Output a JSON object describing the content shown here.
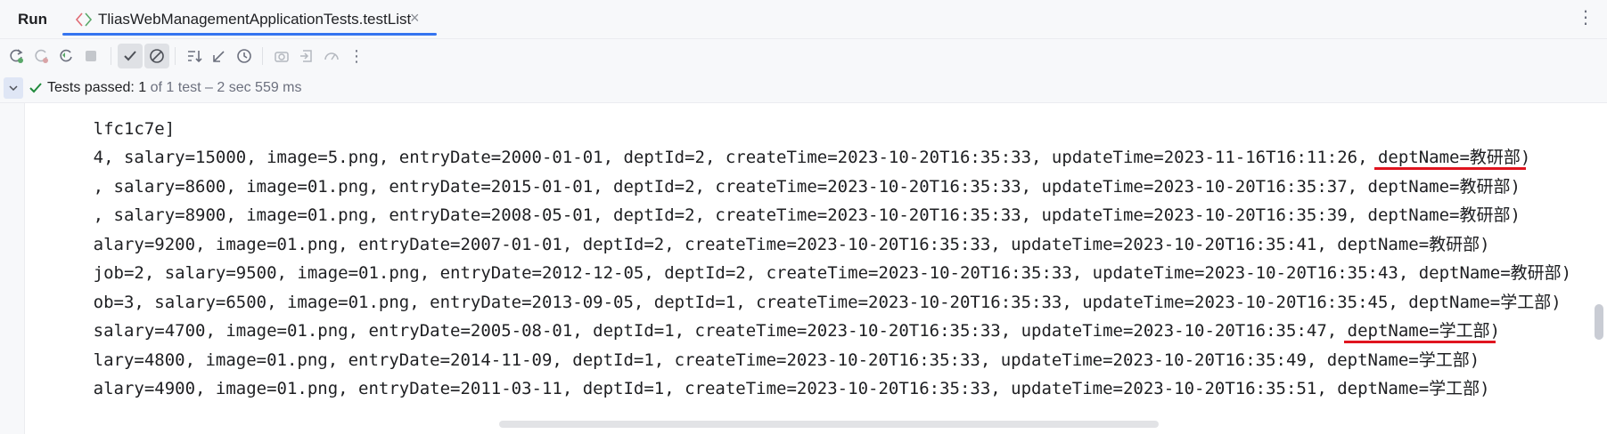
{
  "run_panel": {
    "title": "Run",
    "tab": {
      "label": "TliasWebManagementApplicationTests.testList",
      "close": "×"
    }
  },
  "toolbar": {
    "buttons": [
      "rerun-icon",
      "rerun-failed-icon",
      "rerun-auto-icon",
      "stop-icon",
      "show-passed-icon",
      "show-ignored-icon",
      "sort-icon",
      "collapse-all-icon",
      "history-icon",
      "screenshot-icon",
      "export-icon",
      "coverage-icon",
      "more-icon"
    ]
  },
  "status": {
    "label": "Tests passed:",
    "passed": "1",
    "detail": "of 1 test – 2 sec 559 ms"
  },
  "console": {
    "lines": [
      {
        "text": "lfc1c7e]",
        "hl": "",
        "tail": ""
      },
      {
        "text": "4, salary=15000, image=5.png, entryDate=2000-01-01, deptId=2, createTime=2023-10-20T16:35:33, updateTime=2023-11-16T16:11:26, ",
        "hl": "deptName=教研部",
        "tail": ")"
      },
      {
        "text": ", salary=8600, image=01.png, entryDate=2015-01-01, deptId=2, createTime=2023-10-20T16:35:33, updateTime=2023-10-20T16:35:37, deptName=教研部)",
        "hl": "",
        "tail": ""
      },
      {
        "text": ", salary=8900, image=01.png, entryDate=2008-05-01, deptId=2, createTime=2023-10-20T16:35:33, updateTime=2023-10-20T16:35:39, deptName=教研部)",
        "hl": "",
        "tail": ""
      },
      {
        "text": "alary=9200, image=01.png, entryDate=2007-01-01, deptId=2, createTime=2023-10-20T16:35:33, updateTime=2023-10-20T16:35:41, deptName=教研部)",
        "hl": "",
        "tail": ""
      },
      {
        "text": "job=2, salary=9500, image=01.png, entryDate=2012-12-05, deptId=2, createTime=2023-10-20T16:35:33, updateTime=2023-10-20T16:35:43, deptName=教研部)",
        "hl": "",
        "tail": ""
      },
      {
        "text": "ob=3, salary=6500, image=01.png, entryDate=2013-09-05, deptId=1, createTime=2023-10-20T16:35:33, updateTime=2023-10-20T16:35:45, deptName=学工部)",
        "hl": "",
        "tail": ""
      },
      {
        "text": "salary=4700, image=01.png, entryDate=2005-08-01, deptId=1, createTime=2023-10-20T16:35:33, updateTime=2023-10-20T16:35:47, ",
        "hl": "deptName=学工部",
        "tail": ")"
      },
      {
        "text": "lary=4800, image=01.png, entryDate=2014-11-09, deptId=1, createTime=2023-10-20T16:35:33, updateTime=2023-10-20T16:35:49, deptName=学工部)",
        "hl": "",
        "tail": ""
      },
      {
        "text": "alary=4900, image=01.png, entryDate=2011-03-11, deptId=1, createTime=2023-10-20T16:35:33, updateTime=2023-10-20T16:35:51, deptName=学工部)",
        "hl": "",
        "tail": ""
      }
    ]
  },
  "colors": {
    "accent": "#3574f0",
    "pass": "#208a3c",
    "underline_mark": "#e0141f"
  }
}
